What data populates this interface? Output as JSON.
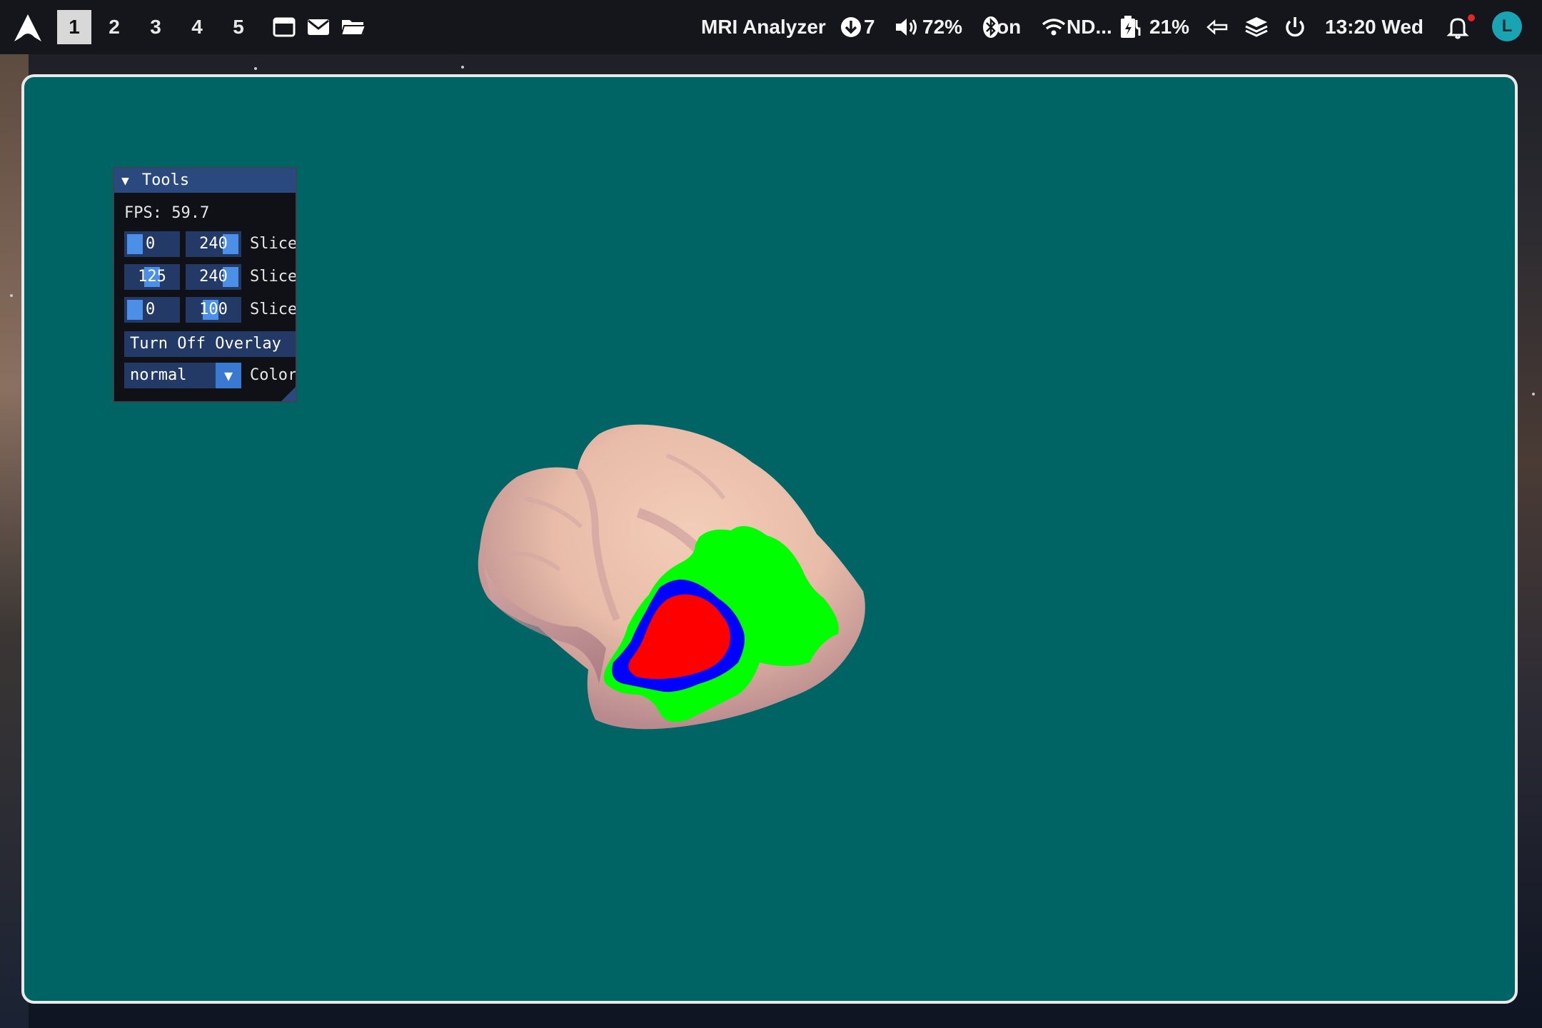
{
  "topbar": {
    "workspaces": [
      "1",
      "2",
      "3",
      "4",
      "5"
    ],
    "active_workspace": "1",
    "app_title": "MRI Analyzer",
    "updates": "7",
    "volume": "72%",
    "bluetooth": "on",
    "wifi": "ND...",
    "battery": "21%",
    "clock": "13:20 Wed",
    "avatar_letter": "L",
    "icons": [
      "arch-logo-icon",
      "window-icon",
      "mail-icon",
      "folder-icon",
      "download-icon",
      "volume-icon",
      "bluetooth-icon",
      "wifi-icon",
      "battery-charging-icon",
      "back-arrow-icon",
      "layers-icon",
      "power-icon",
      "bell-icon"
    ]
  },
  "tools": {
    "title": "Tools",
    "fps": "FPS: 59.7",
    "rows": [
      {
        "min": "0",
        "max": "240",
        "label": "Slice"
      },
      {
        "min": "125",
        "max": "240",
        "label": "Slice"
      },
      {
        "min": "0",
        "max": "100",
        "label": "Slice"
      }
    ],
    "overlay_button": "Turn Off Overlay",
    "color_mode": "normal",
    "color_label": "Color"
  },
  "colors": {
    "viewport_bg": "#006464",
    "panel_title": "#2a4a7f",
    "slider_fill": "#4c8fe6",
    "brain": "#eec4b0",
    "overlay_green": "#00ff00",
    "overlay_blue": "#0000ff",
    "overlay_red": "#ff0000"
  }
}
